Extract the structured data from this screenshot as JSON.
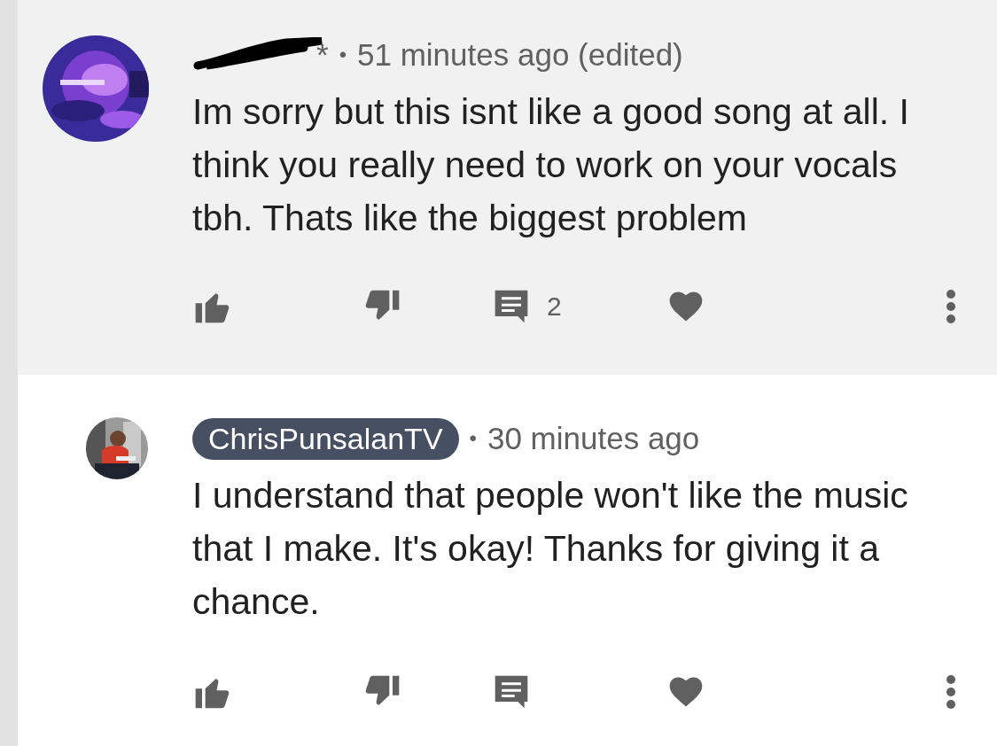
{
  "comments": [
    {
      "kind": "comment",
      "author_redacted": true,
      "author_visible": "*",
      "separator": "•",
      "time": "51 minutes ago (edited)",
      "text": "Im sorry but this isnt like a good song at all. I think you really need to work on your vocals tbh. Thats like the biggest problem",
      "reply_count": "2"
    },
    {
      "kind": "reply",
      "author": "ChrisPunsalanTV",
      "author_badge": true,
      "separator": "•",
      "time": "30 minutes ago",
      "text": "I understand that people won't like the music that I make. It's okay! Thanks for giving it a chance."
    }
  ]
}
